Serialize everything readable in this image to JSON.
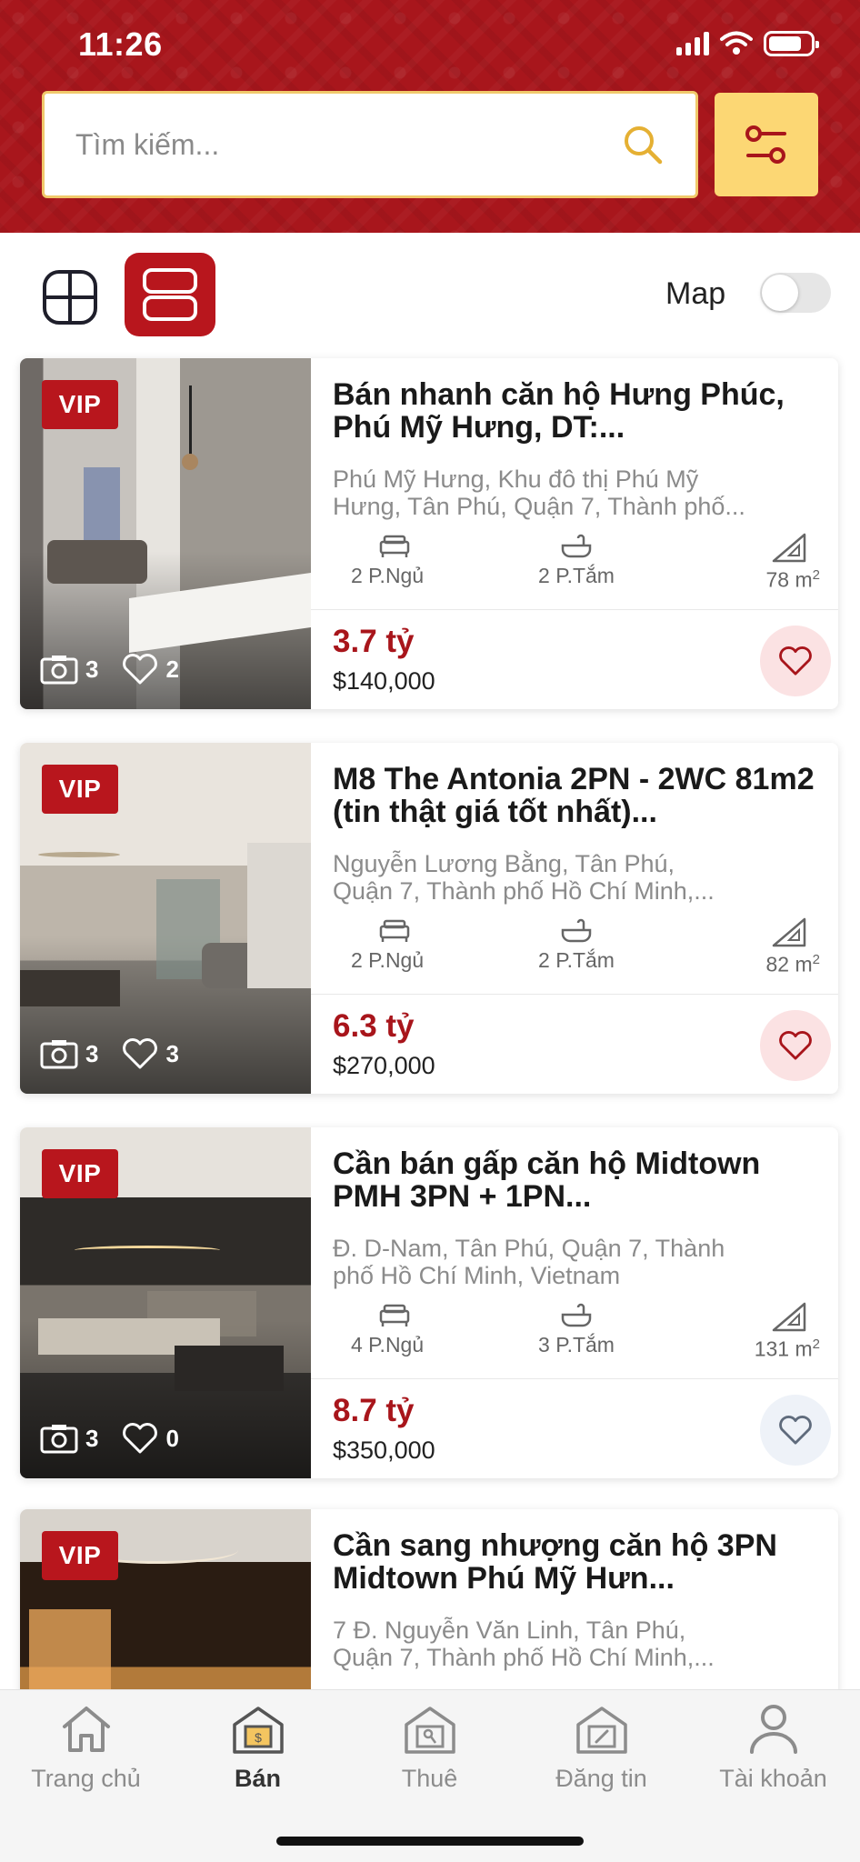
{
  "status_bar": {
    "time": "11:26"
  },
  "search": {
    "placeholder": "Tìm kiếm..."
  },
  "view": {
    "map_label": "Map",
    "map_enabled": false,
    "mode": "list"
  },
  "listings": [
    {
      "vip": "VIP",
      "title": "Bán nhanh căn hộ Hưng Phúc, Phú Mỹ Hưng, DT:...",
      "address_line1": "Phú Mỹ Hưng, Khu đô thị Phú Mỹ",
      "address_line2": "Hưng, Tân Phú, Quận 7, Thành phố...",
      "photos": "3",
      "likes": "2",
      "bedrooms": "2 P.Ngủ",
      "bathrooms": "2 P.Tắm",
      "area": "78 m",
      "area_sup": "2",
      "price_vnd": "3.7 tỷ",
      "price_usd": "$140,000",
      "favorited": true
    },
    {
      "vip": "VIP",
      "title": "M8 The Antonia 2PN - 2WC 81m2 (tin thật giá tốt nhất)...",
      "address_line1": "Nguyễn Lương Bằng, Tân Phú,",
      "address_line2": "Quận 7, Thành phố Hồ Chí Minh,...",
      "photos": "3",
      "likes": "3",
      "bedrooms": "2 P.Ngủ",
      "bathrooms": "2 P.Tắm",
      "area": "82 m",
      "area_sup": "2",
      "price_vnd": "6.3 tỷ",
      "price_usd": "$270,000",
      "favorited": true
    },
    {
      "vip": "VIP",
      "title": "Cần bán gấp căn hộ Midtown PMH 3PN + 1PN...",
      "address_line1": "Đ. D-Nam, Tân Phú, Quận 7, Thành",
      "address_line2": "phố Hồ Chí Minh, Vietnam",
      "photos": "3",
      "likes": "0",
      "bedrooms": "4 P.Ngủ",
      "bathrooms": "3 P.Tắm",
      "area": "131 m",
      "area_sup": "2",
      "price_vnd": "8.7 tỷ",
      "price_usd": "$350,000",
      "favorited": false
    },
    {
      "vip": "VIP",
      "title": "Cần sang nhượng căn hộ 3PN Midtown Phú Mỹ Hưn...",
      "address_line1": "7 Đ. Nguyễn Văn Linh, Tân Phú,",
      "address_line2": "Quận 7, Thành phố Hồ Chí Minh,...",
      "photos": "",
      "likes": "",
      "bedrooms": "",
      "bathrooms": "",
      "area": "",
      "area_sup": "",
      "price_vnd": "",
      "price_usd": "",
      "favorited": false
    }
  ],
  "nav": [
    {
      "label": "Trang chủ",
      "icon": "home-icon",
      "active": false
    },
    {
      "label": "Bán",
      "icon": "sell-icon",
      "active": true
    },
    {
      "label": "Thuê",
      "icon": "rent-icon",
      "active": false
    },
    {
      "label": "Đăng tin",
      "icon": "post-icon",
      "active": false
    },
    {
      "label": "Tài khoản",
      "icon": "account-icon",
      "active": false
    }
  ],
  "colors": {
    "brand_red": "#a8161c",
    "accent_yellow": "#fcd774",
    "price_red": "#a8151b"
  }
}
